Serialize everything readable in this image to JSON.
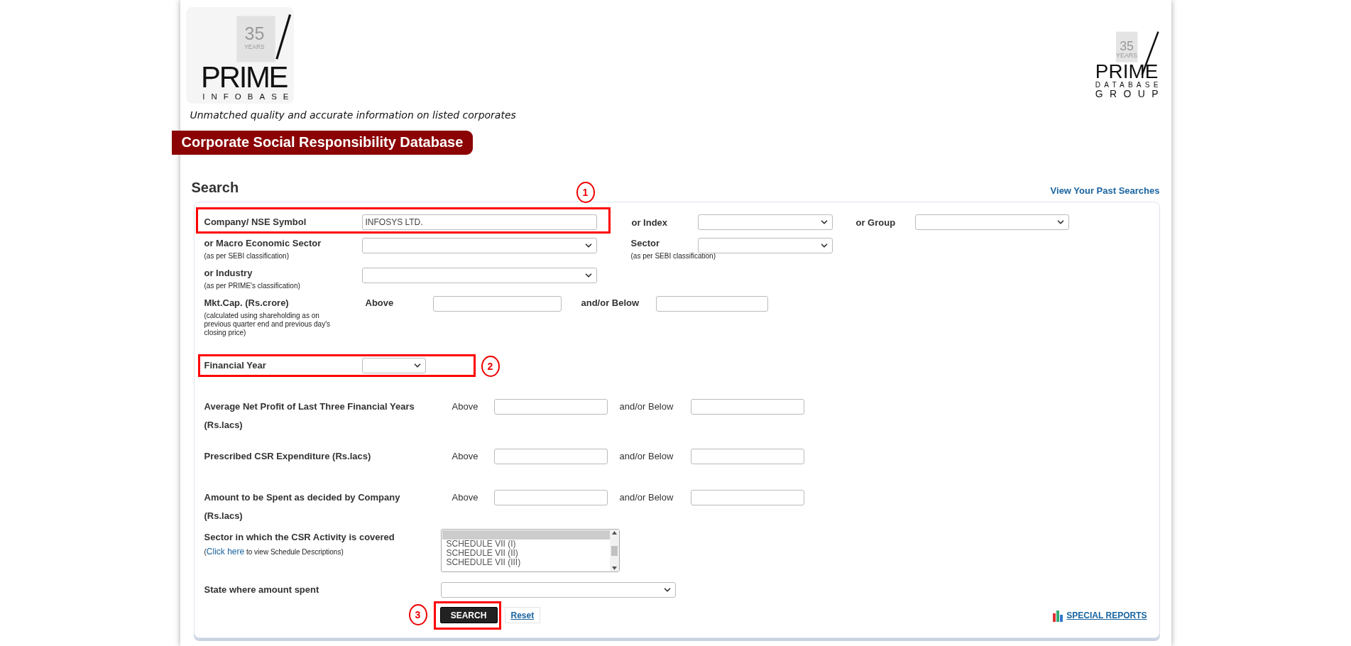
{
  "header": {
    "logo": {
      "years": "35",
      "years_label": "YEARS",
      "name": "PRIME",
      "subtitle": "INFOBASE"
    },
    "tagline": "Unmatched quality and accurate information on listed corporates",
    "group_logo": {
      "years": "35",
      "years_label": "YEARS",
      "name": "PRIME",
      "line1": "DATABASE",
      "line2": "GROUP"
    }
  },
  "banner": "Corporate Social Responsibility Database",
  "search": {
    "title": "Search",
    "past_searches_link": "View Your Past Searches",
    "rows": [
      {
        "kind": "company",
        "label": "Company/ NSE Symbol",
        "value": "INFOSYS LTD.",
        "index_label": "or Index",
        "group_label": "or Group",
        "annotation": "1"
      },
      {
        "kind": "select_pair",
        "label": "or Macro Economic Sector",
        "note": "(as per SEBI classification)",
        "sector_label": "Sector",
        "sector_note": "(as per SEBI classification)"
      },
      {
        "kind": "select",
        "label": "or Industry",
        "note": "(as per PRIME's classification)"
      },
      {
        "kind": "mktcap",
        "label": "Mkt.Cap. (Rs.crore)",
        "note": "(calculated using shareholding as on previous quarter end and previous day's closing price)",
        "above": "Above",
        "below": "and/or Below"
      },
      {
        "kind": "year",
        "label": "Financial Year",
        "annotation": "2"
      },
      {
        "kind": "range",
        "label": "Average Net Profit of Last Three Financial Years (Rs.lacs)",
        "above": "Above",
        "below": "and/or Below"
      },
      {
        "kind": "range",
        "label": "Prescribed CSR Expenditure (Rs.lacs)",
        "above": "Above",
        "below": "and/or Below"
      },
      {
        "kind": "range",
        "label": "Amount to be Spent as decided by Company (Rs.lacs)",
        "above": "Above",
        "below": "and/or Below"
      },
      {
        "kind": "listbox",
        "label": "Sector in which the CSR Activity is covered",
        "note_before": "(",
        "note_link": "Click here",
        "note_after": " to view Schedule Descriptions)",
        "blank_row_highlighted": true,
        "options": [
          "SCHEDULE VII (I)",
          "SCHEDULE VII (II)",
          "SCHEDULE VII (III)"
        ]
      },
      {
        "kind": "state",
        "label": "State where amount spent"
      }
    ],
    "search_button": "SEARCH",
    "search_annotation": "3",
    "reset_button": "Reset",
    "special_reports_link": "SPECIAL REPORTS"
  }
}
